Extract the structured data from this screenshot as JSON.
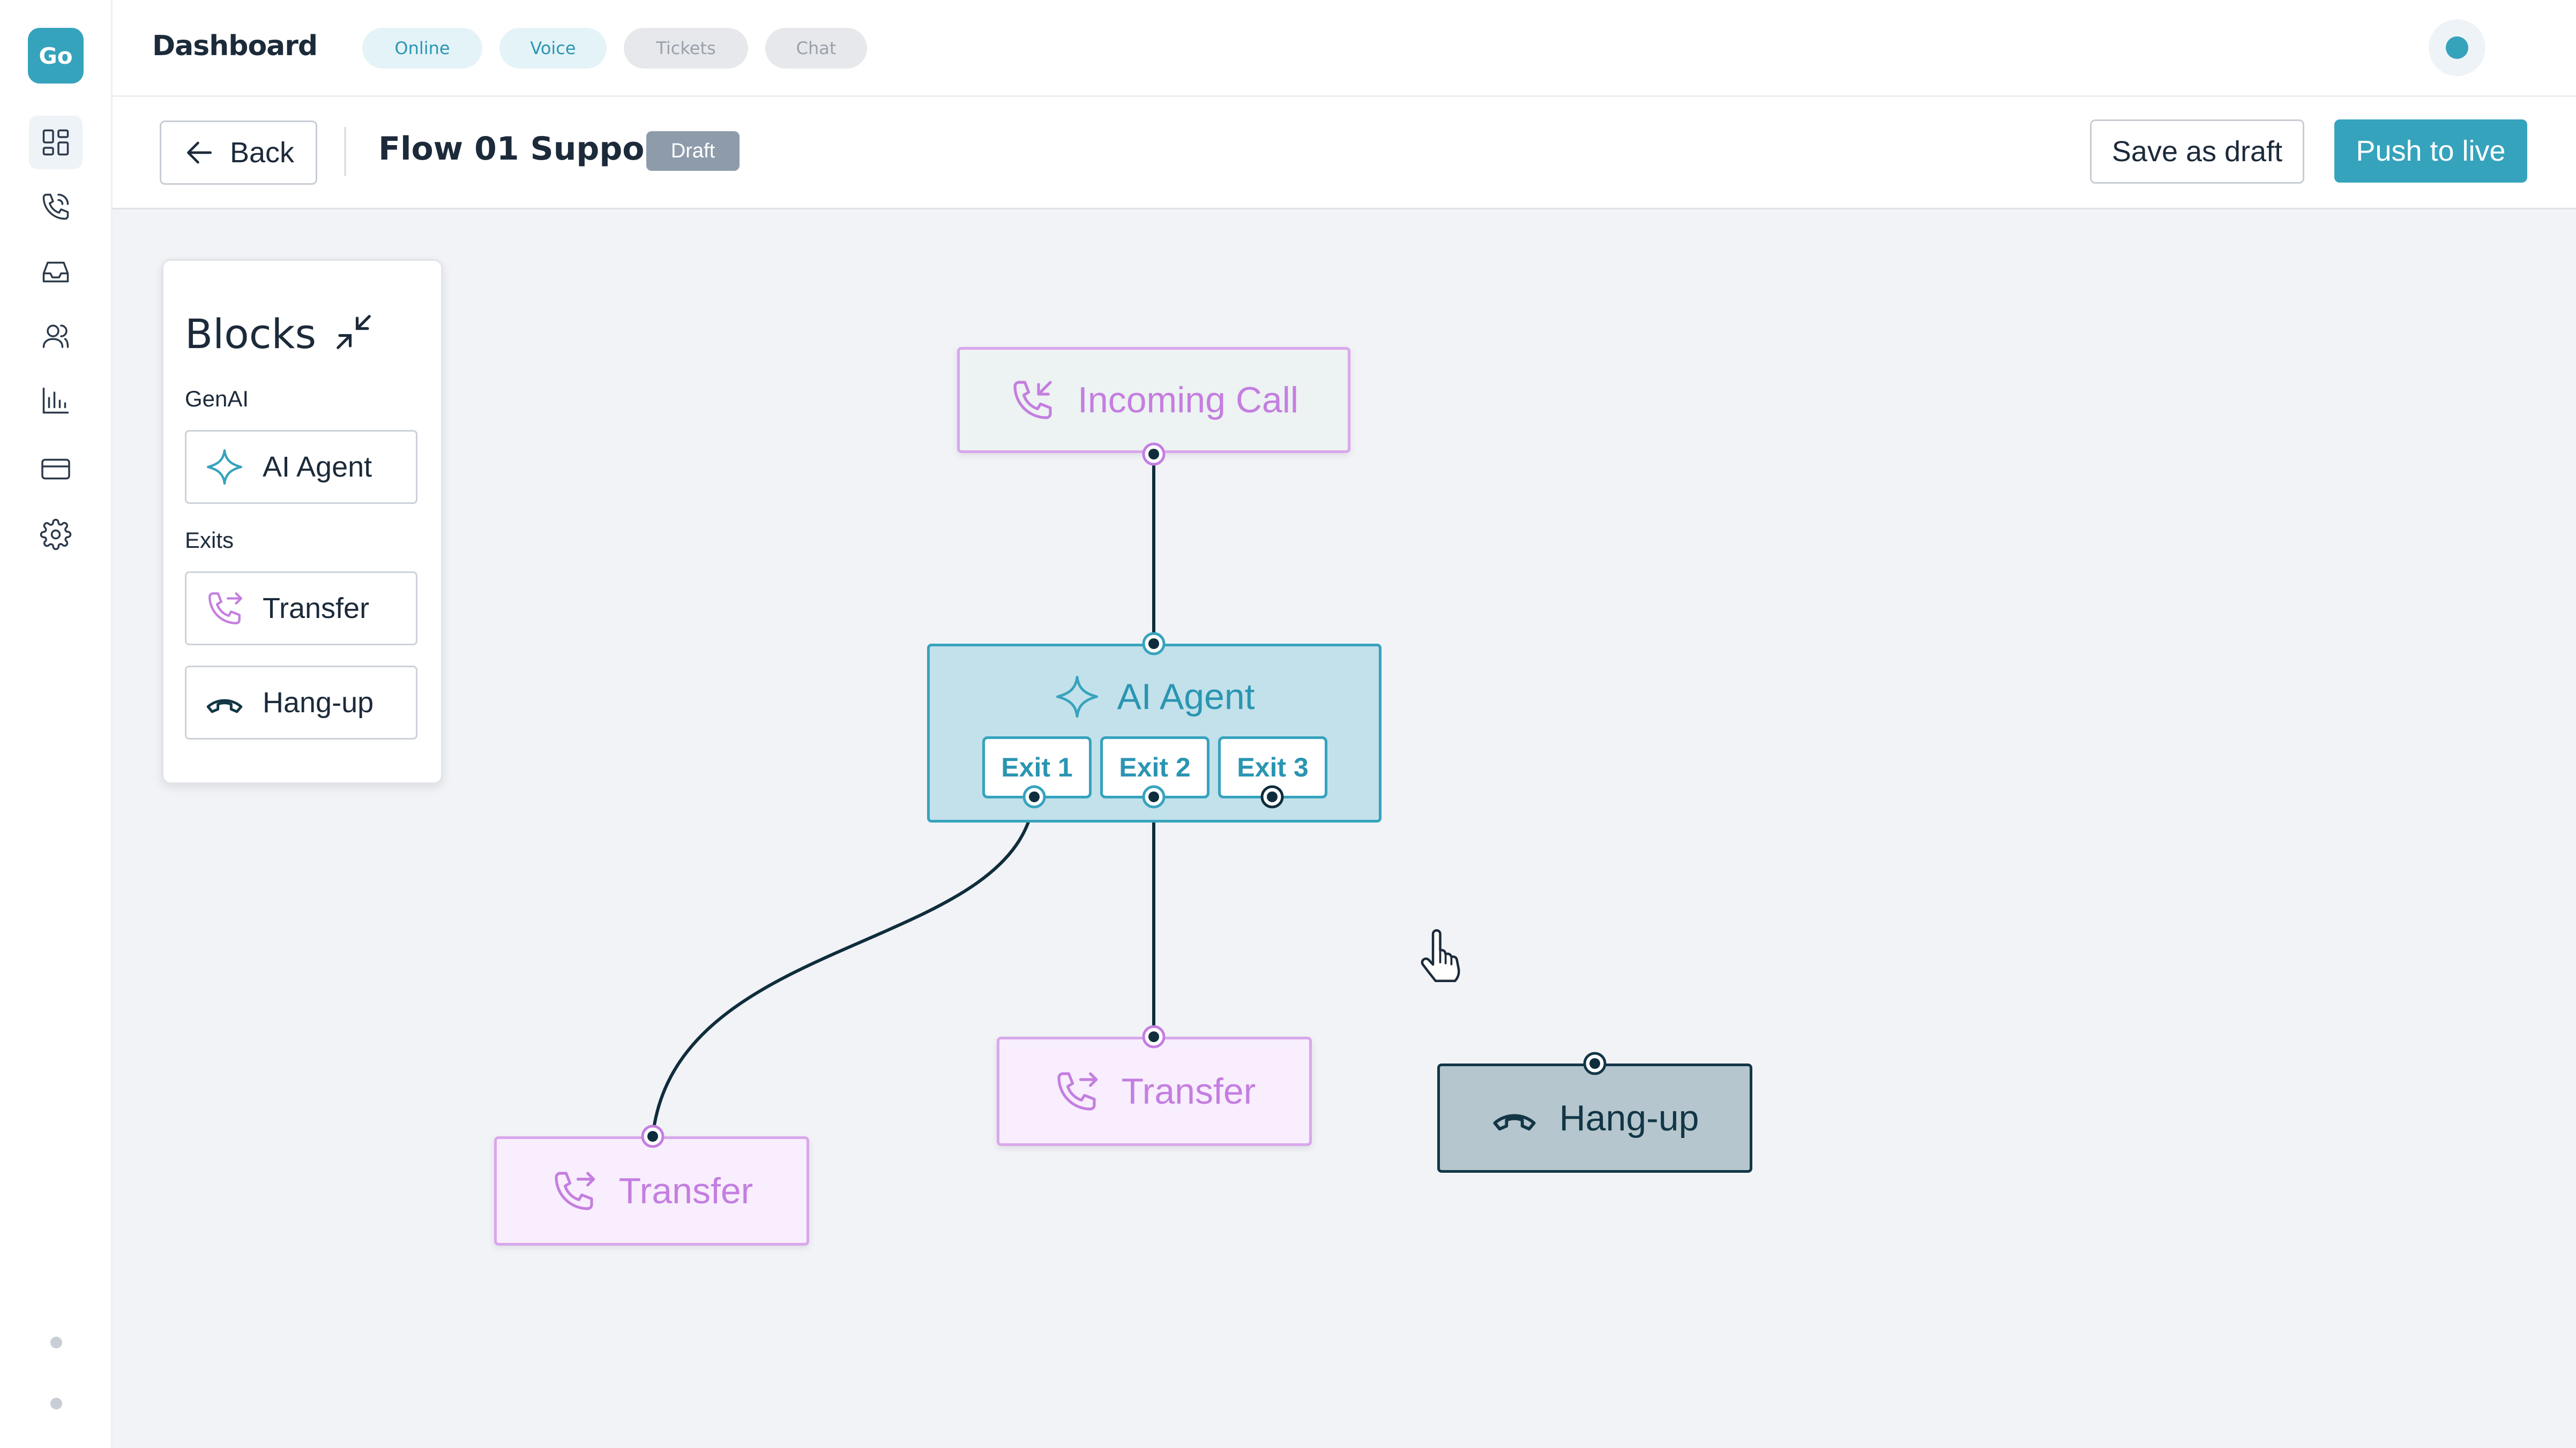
{
  "app": {
    "logo_text": "Go",
    "header_title": "Dashboard",
    "channel_chips": [
      {
        "label": "Online",
        "active": true
      },
      {
        "label": "Voice",
        "active": true
      },
      {
        "label": "Tickets",
        "active": false
      },
      {
        "label": "Chat",
        "active": false
      }
    ],
    "status_color": "#36a3bd"
  },
  "sidebar": {
    "items": [
      {
        "icon": "dashboard-icon",
        "active": true
      },
      {
        "icon": "phone-icon",
        "active": false
      },
      {
        "icon": "inbox-icon",
        "active": false
      },
      {
        "icon": "users-icon",
        "active": false
      },
      {
        "icon": "analytics-icon",
        "active": false
      },
      {
        "icon": "billing-card-icon",
        "active": false
      },
      {
        "icon": "settings-gear-icon",
        "active": false
      }
    ]
  },
  "toolbar": {
    "back_label": "Back",
    "flow_title": "Flow 01 Support",
    "status_badge": "Draft",
    "save_draft_label": "Save as draft",
    "push_live_label": "Push to live"
  },
  "palette": {
    "title": "Blocks",
    "sections": [
      {
        "label": "GenAI",
        "items": [
          {
            "label": "AI Agent",
            "icon": "sparkle-icon"
          }
        ]
      },
      {
        "label": "Exits",
        "items": [
          {
            "label": "Transfer",
            "icon": "phone-transfer-icon"
          },
          {
            "label": "Hang-up",
            "icon": "hang-up-icon"
          }
        ]
      }
    ]
  },
  "flow": {
    "nodes": {
      "incoming": {
        "label": "Incoming Call",
        "icon": "incoming-call-icon"
      },
      "agent": {
        "label": "AI Agent",
        "icon": "sparkle-icon",
        "exits": [
          "Exit 1",
          "Exit 2",
          "Exit 3"
        ]
      },
      "transfer_1": {
        "label": "Transfer",
        "icon": "phone-transfer-icon"
      },
      "transfer_2": {
        "label": "Transfer",
        "icon": "phone-transfer-icon"
      },
      "hangup": {
        "label": "Hang-up",
        "icon": "hang-up-icon"
      }
    },
    "connections": [
      {
        "from": "Incoming Call",
        "to": "AI Agent"
      },
      {
        "from": "Exit 1",
        "to": "Transfer"
      },
      {
        "from": "Exit 2",
        "to": "Transfer"
      }
    ]
  },
  "colors": {
    "accent": "#36a3bd",
    "transfer_accent": "#c47ee0",
    "hangup_dark": "#123646",
    "edge": "#0f2d3c"
  }
}
